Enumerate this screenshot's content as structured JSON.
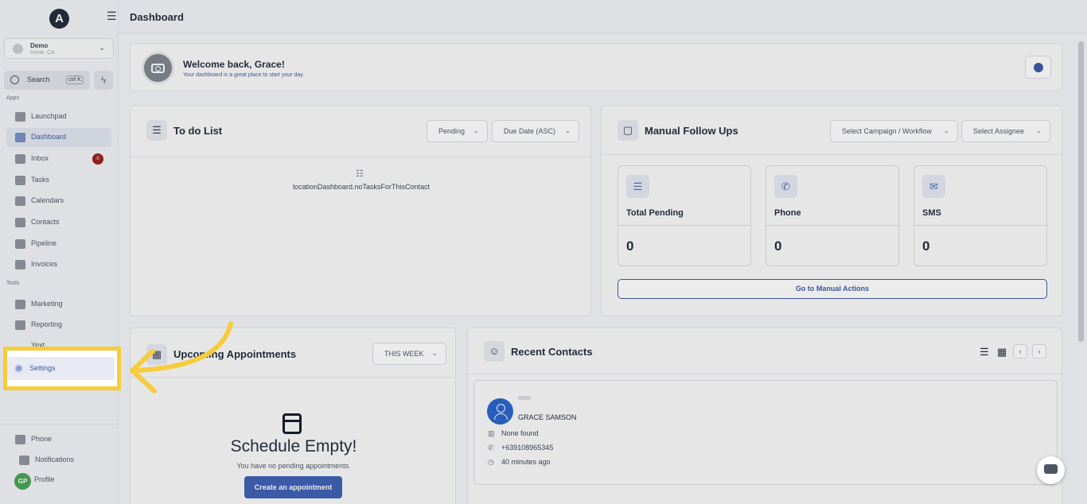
{
  "sidebar": {
    "logo": "A",
    "account": {
      "name": "Demo",
      "location": "Irvine, CA"
    },
    "search": {
      "label": "Search",
      "shortcut": "ctrl K"
    },
    "sections": {
      "apps": "Apps",
      "tools": "Tools"
    },
    "apps": [
      {
        "label": "Launchpad",
        "icon": "rocket-icon"
      },
      {
        "label": "Dashboard",
        "icon": "grid-icon",
        "active": true
      },
      {
        "label": "Inbox",
        "icon": "inbox-icon",
        "badge": "0"
      },
      {
        "label": "Tasks",
        "icon": "clipboard-icon"
      },
      {
        "label": "Calendars",
        "icon": "calendar-icon"
      },
      {
        "label": "Contacts",
        "icon": "person-icon"
      },
      {
        "label": "Pipeline",
        "icon": "funnel-icon"
      },
      {
        "label": "Invoices",
        "icon": "invoice-icon"
      }
    ],
    "tools": [
      {
        "label": "Marketing",
        "icon": "megaphone-icon"
      },
      {
        "label": "Reporting",
        "icon": "pie-chart-icon"
      }
    ],
    "hidden_item_partial": "Yext",
    "settings_label": "Settings",
    "bottom": [
      {
        "label": "Phone",
        "icon": "phone-icon"
      },
      {
        "label": "Notifications",
        "icon": "bell-icon"
      },
      {
        "label": "Profile",
        "icon": "avatar-icon",
        "initials": "GP"
      }
    ]
  },
  "header": {
    "title": "Dashboard"
  },
  "welcome": {
    "title": "Welcome back, Grace!",
    "subtitle": "Your dashboard is a great place to start your day."
  },
  "todo": {
    "title": "To do List",
    "status_filter": "Pending",
    "sort_filter": "Due Date (ASC)",
    "empty_text": "locationDashboard.noTasksForThisContact"
  },
  "manual_follow_ups": {
    "title": "Manual Follow Ups",
    "campaign_filter": "Select Campaign / Workflow",
    "assignee_filter": "Select Assignee",
    "stats": [
      {
        "label": "Total Pending",
        "value": "0",
        "icon": "list-check-icon"
      },
      {
        "label": "Phone",
        "value": "0",
        "icon": "phone-icon"
      },
      {
        "label": "SMS",
        "value": "0",
        "icon": "message-icon"
      }
    ],
    "action_label": "Go to Manual Actions"
  },
  "appointments": {
    "title": "Upcoming Appointments",
    "range_filter": "THIS WEEK",
    "empty_title": "Schedule Empty!",
    "empty_sub": "You have no pending appointments.",
    "create_label": "Create an appointment"
  },
  "recent_contacts": {
    "title": "Recent Contacts",
    "contacts": [
      {
        "name": "GRACE SAMSON",
        "company": "None found",
        "phone": "+639108965345",
        "time": "40 minutes ago"
      }
    ]
  },
  "colors": {
    "accent": "#3b5aa0",
    "highlight": "#f5cc3c",
    "badge": "#9b1c1c"
  }
}
